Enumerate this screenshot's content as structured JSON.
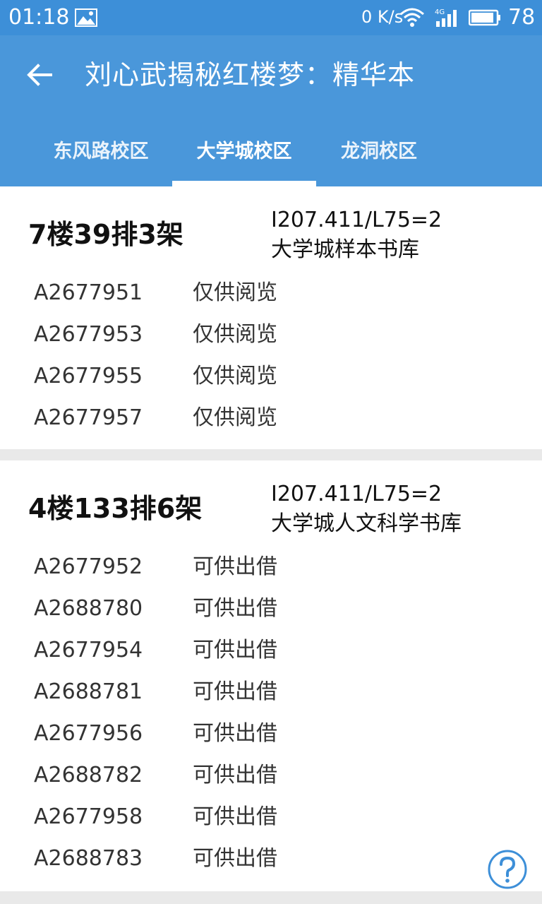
{
  "status_bar": {
    "time": "01:18",
    "network_speed": "0 K/s",
    "battery": "78",
    "icons": [
      "image-icon",
      "wifi-icon",
      "signal-4g-icon",
      "battery-icon"
    ]
  },
  "app_bar": {
    "title": "刘心武揭秘红楼梦：精华本",
    "back_icon": "back-arrow-icon",
    "accent_color": "#4a97da"
  },
  "tabs": [
    {
      "label": "东风路校区",
      "active": false
    },
    {
      "label": "大学城校区",
      "active": true
    },
    {
      "label": "龙洞校区",
      "active": false
    }
  ],
  "holdings": [
    {
      "location": "7楼39排3架",
      "call_number": "I207.411/L75=2",
      "library": "大学城样本书库",
      "items": [
        {
          "barcode": "A2677951",
          "status": "仅供阅览"
        },
        {
          "barcode": "A2677953",
          "status": "仅供阅览"
        },
        {
          "barcode": "A2677955",
          "status": "仅供阅览"
        },
        {
          "barcode": "A2677957",
          "status": "仅供阅览"
        }
      ]
    },
    {
      "location": "4楼133排6架",
      "call_number": "I207.411/L75=2",
      "library": "大学城人文科学书库",
      "items": [
        {
          "barcode": "A2677952",
          "status": "可供出借"
        },
        {
          "barcode": "A2688780",
          "status": "可供出借"
        },
        {
          "barcode": "A2677954",
          "status": "可供出借"
        },
        {
          "barcode": "A2688781",
          "status": "可供出借"
        },
        {
          "barcode": "A2677956",
          "status": "可供出借"
        },
        {
          "barcode": "A2688782",
          "status": "可供出借"
        },
        {
          "barcode": "A2677958",
          "status": "可供出借"
        },
        {
          "barcode": "A2688783",
          "status": "可供出借"
        }
      ]
    }
  ],
  "help_icon": "help-icon"
}
